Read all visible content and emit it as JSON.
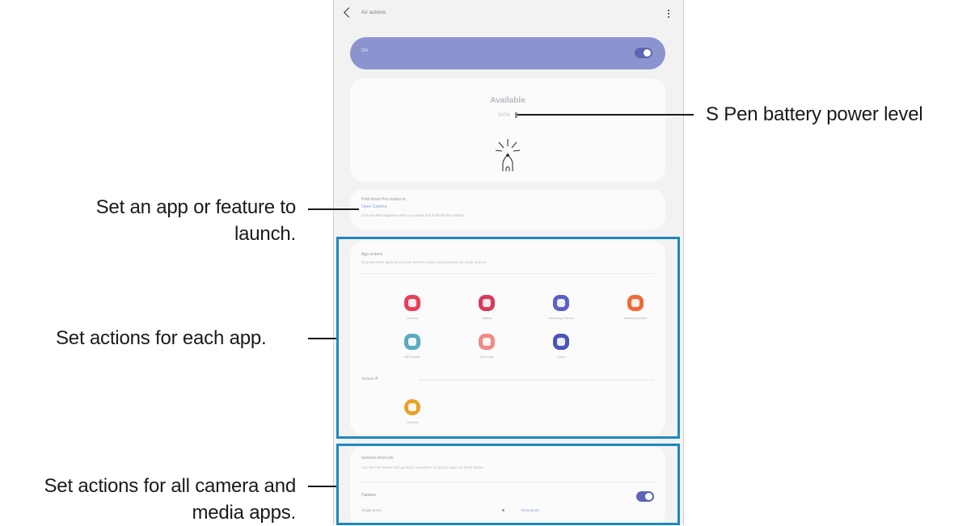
{
  "screen": {
    "title": "Air actions",
    "master_toggle_label": "On",
    "status_title": "Available",
    "battery_text": "100%",
    "launch": {
      "title": "Hold down Pen button to",
      "value": "Open Camera",
      "desc": "Choose what happens when you press and hold the Pen button."
    },
    "app_actions": {
      "title": "App actions",
      "desc": "Choose which apps let you use the Pen button and gestures for quick actions.",
      "apps": [
        {
          "label": "Camera",
          "color": "#e8405a"
        },
        {
          "label": "Gallery",
          "color": "#d93a5b"
        },
        {
          "label": "Samsung Internet",
          "color": "#5b5fc7"
        },
        {
          "label": "Samsung Notes",
          "color": "#ef6a3a"
        },
        {
          "label": "AR Doodle",
          "color": "#5aaac0"
        },
        {
          "label": "AR Emoji",
          "color": "#f08a86"
        },
        {
          "label": "Voice",
          "color": "#4b55b8"
        }
      ],
      "turned_off_label": "Turned off",
      "off_apps": [
        {
          "label": "Chrome",
          "color": "#e8a028"
        }
      ]
    },
    "general": {
      "title": "General shortcuts",
      "desc": "Use the Pen button and gestures anywhere, including apps not listed above.",
      "media_label": "Camera",
      "single_press_label": "Single press",
      "single_press_value": "Next photo"
    }
  },
  "callouts": {
    "battery": "S Pen battery power level",
    "launch_line1": "Set an app or feature to",
    "launch_line2": "launch.",
    "each_app": "Set actions for each app.",
    "media_line1": "Set actions for all camera and",
    "media_line2": "media apps."
  },
  "colors": {
    "accent_bar": "#8b94cf",
    "highlight": "#1d88be"
  }
}
